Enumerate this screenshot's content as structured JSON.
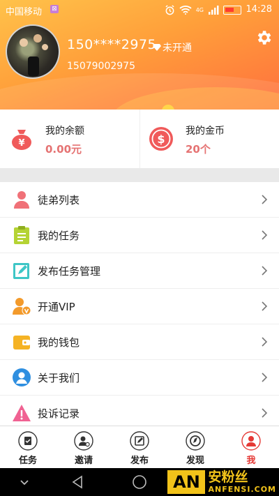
{
  "status_bar": {
    "carrier": "中国移动",
    "sim_badge": "⊠",
    "network": "4G",
    "time": "14:28"
  },
  "profile": {
    "username": "150****2975",
    "vip_status": "未开通",
    "user_id": "15079002975"
  },
  "balances": [
    {
      "title": "我的余额",
      "value": "0.00元",
      "icon": "money-bag-icon"
    },
    {
      "title": "我的金币",
      "value": "20个",
      "icon": "dollar-coin-icon"
    }
  ],
  "menu": [
    {
      "label": "徒弟列表",
      "icon": "person-icon",
      "color": "#f07178"
    },
    {
      "label": "我的任务",
      "icon": "clipboard-icon",
      "color": "#b5d334"
    },
    {
      "label": "发布任务管理",
      "icon": "edit-icon",
      "color": "#3ec6c6"
    },
    {
      "label": "开通VIP",
      "icon": "vip-user-icon",
      "color": "#f39a2b"
    },
    {
      "label": "我的钱包",
      "icon": "wallet-icon",
      "color": "#f5b324"
    },
    {
      "label": "关于我们",
      "icon": "user-circle-icon",
      "color": "#2f8fe0"
    },
    {
      "label": "投诉记录",
      "icon": "warning-icon",
      "color": "#f06292"
    }
  ],
  "tabs": [
    {
      "label": "任务",
      "icon": "task-icon",
      "active": false
    },
    {
      "label": "邀请",
      "icon": "invite-icon",
      "active": false
    },
    {
      "label": "发布",
      "icon": "publish-icon",
      "active": false
    },
    {
      "label": "发现",
      "icon": "discover-icon",
      "active": false
    },
    {
      "label": "我",
      "icon": "me-icon",
      "active": true
    }
  ],
  "watermark": {
    "logo": "AN",
    "cn": "安粉丝",
    "en": "ANFENSI.COM"
  },
  "colors": {
    "header_start": "#ffc24a",
    "header_end": "#ff6f3e",
    "accent_red": "#e53935",
    "value_red": "#e57373"
  }
}
